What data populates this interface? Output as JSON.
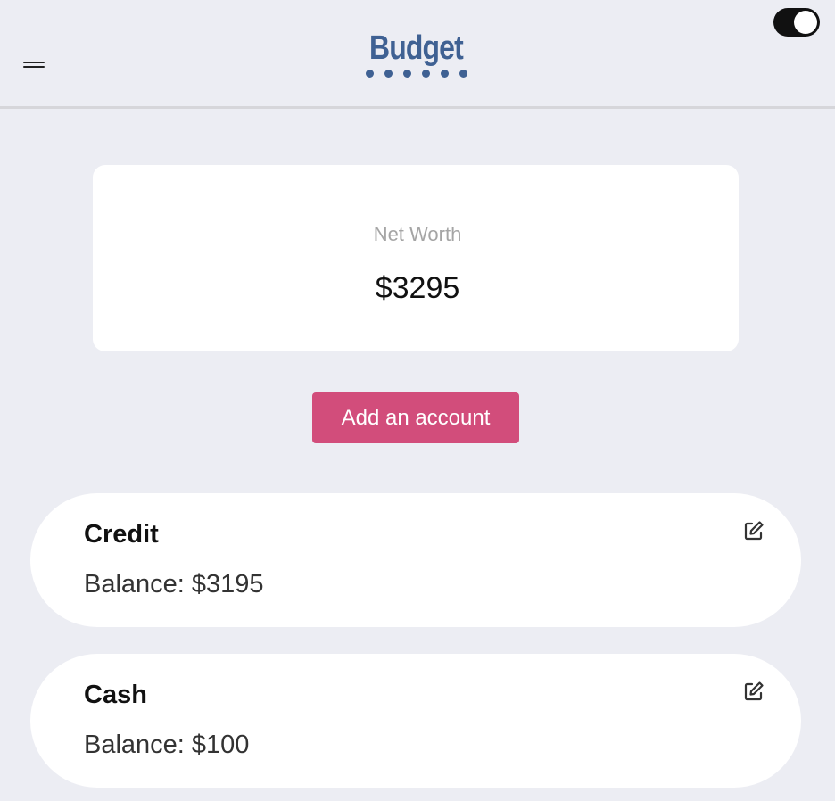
{
  "header": {
    "logo_text": "Budget",
    "menu_icon": "hamburger-menu-icon",
    "theme_toggle": {
      "state": "on",
      "icon": "toggle-switch-icon"
    }
  },
  "net_worth": {
    "label": "Net Worth",
    "value": "$3295"
  },
  "add_account": {
    "label": "Add an account",
    "color": "#d24d7b"
  },
  "accounts": [
    {
      "name": "Credit",
      "balance": "Balance: $3195",
      "edit_icon": "edit-icon"
    },
    {
      "name": "Cash",
      "balance": "Balance: $100",
      "edit_icon": "edit-icon"
    }
  ],
  "colors": {
    "background": "#ecedf3",
    "brand": "#3f6193",
    "accent": "#d24d7b"
  }
}
